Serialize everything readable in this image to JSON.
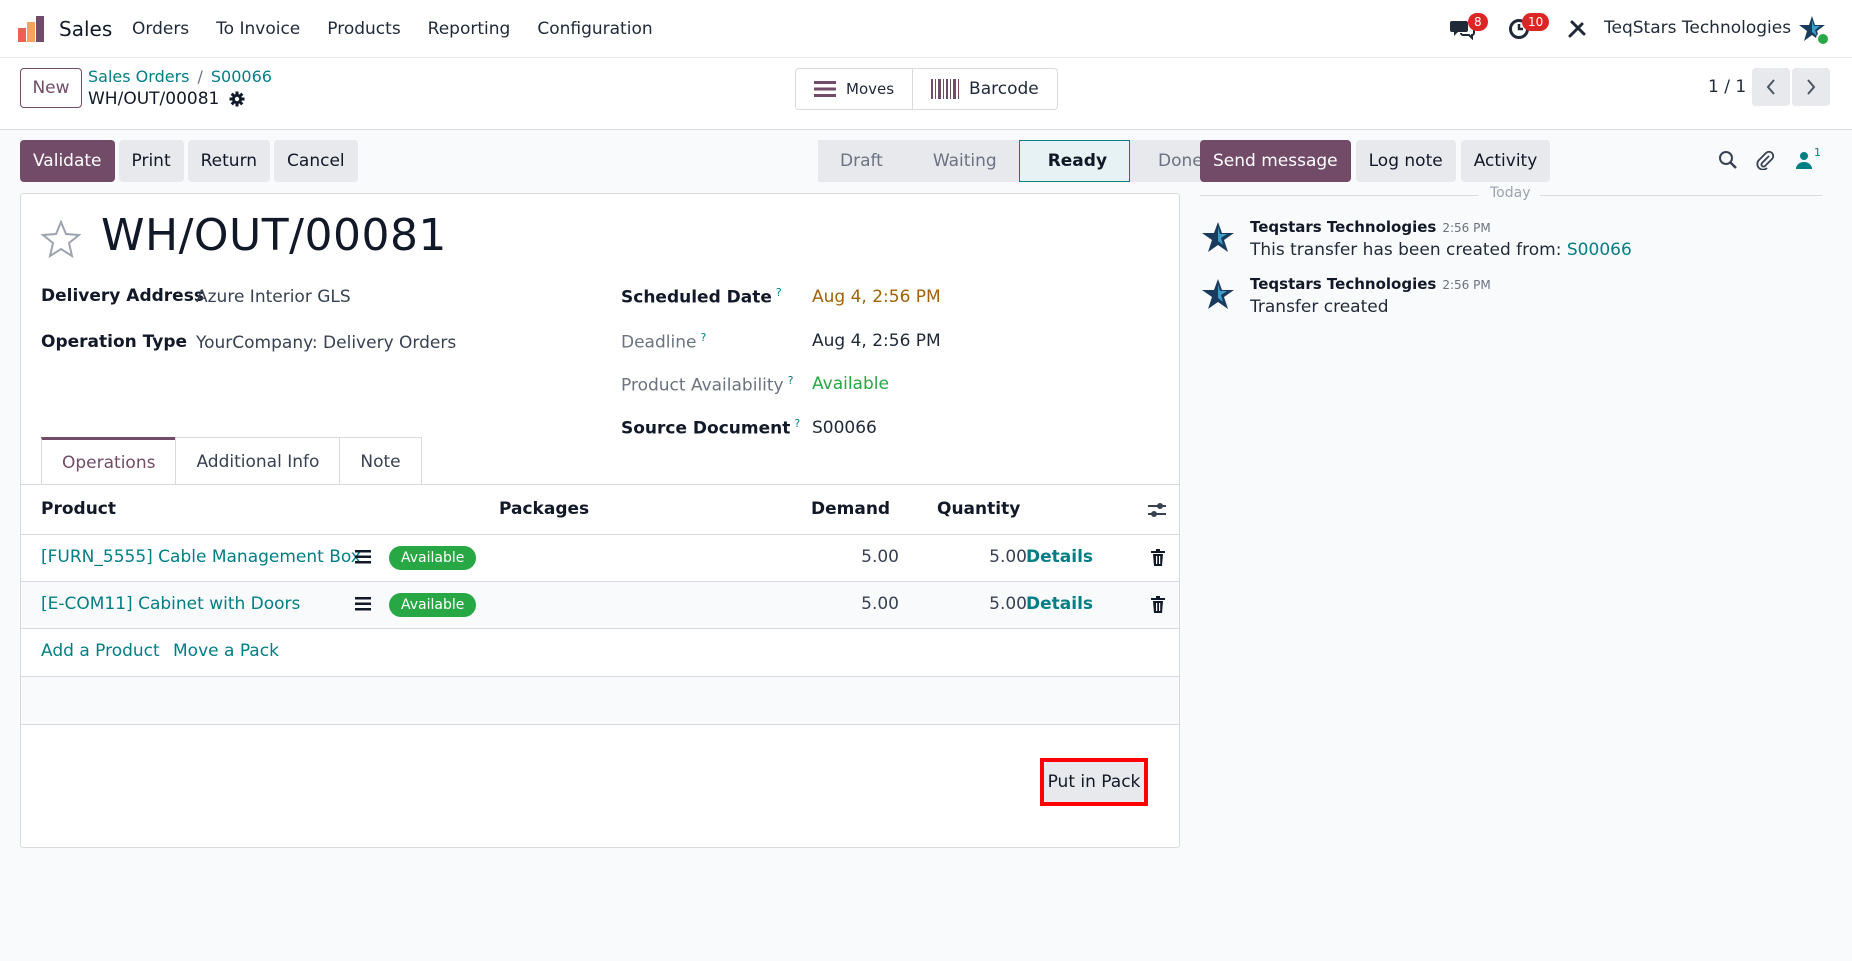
{
  "app": {
    "name": "Sales",
    "menu": [
      "Orders",
      "To Invoice",
      "Products",
      "Reporting",
      "Configuration"
    ]
  },
  "systray": {
    "messages_count": "8",
    "activities_count": "10",
    "company": "TeqStars Technologies"
  },
  "control": {
    "new_label": "New",
    "breadcrumb": [
      "Sales Orders",
      "S00066"
    ],
    "current": "WH/OUT/00081",
    "moves_label": "Moves",
    "barcode_label": "Barcode",
    "pager": "1 / 1"
  },
  "actions": {
    "validate": "Validate",
    "print": "Print",
    "return": "Return",
    "cancel": "Cancel"
  },
  "stages": {
    "items": [
      "Draft",
      "Waiting",
      "Ready",
      "Done"
    ],
    "active": "Ready"
  },
  "record": {
    "title": "WH/OUT/00081",
    "fields": {
      "delivery_address_label": "Delivery Address",
      "delivery_address": "Azure Interior GLS",
      "operation_type_label": "Operation Type",
      "operation_type": "YourCompany: Delivery Orders",
      "scheduled_date_label": "Scheduled Date",
      "scheduled_date": "Aug 4, 2:56 PM",
      "deadline_label": "Deadline",
      "deadline": "Aug 4, 2:56 PM",
      "availability_label": "Product Availability",
      "availability": "Available",
      "source_label": "Source Document",
      "source": "S00066"
    },
    "help_mark": "?"
  },
  "tabs": [
    "Operations",
    "Additional Info",
    "Note"
  ],
  "table": {
    "headers": {
      "product": "Product",
      "packages": "Packages",
      "demand": "Demand",
      "quantity": "Quantity"
    },
    "rows": [
      {
        "product": "[FURN_5555] Cable Management Box",
        "status": "Available",
        "demand": "5.00",
        "quantity": "5.00",
        "details": "Details"
      },
      {
        "product": "[E-COM11] Cabinet with Doors",
        "status": "Available",
        "demand": "5.00",
        "quantity": "5.00",
        "details": "Details"
      }
    ],
    "add_product": "Add a Product",
    "move_pack": "Move a Pack"
  },
  "put_in_pack": "Put in Pack",
  "chatter": {
    "send_message": "Send message",
    "log_note": "Log note",
    "activity": "Activity",
    "followers_count": "1",
    "today": "Today",
    "messages": [
      {
        "author": "Teqstars Technologies",
        "time": "2:56 PM",
        "body": "This transfer has been created from:",
        "link": "S00066"
      },
      {
        "author": "Teqstars Technologies",
        "time": "2:56 PM",
        "body": "Transfer created",
        "link": ""
      }
    ]
  },
  "colors": {
    "brand": "#714b67",
    "link": "#017e84",
    "success": "#28a745",
    "danger": "#dc2626"
  }
}
